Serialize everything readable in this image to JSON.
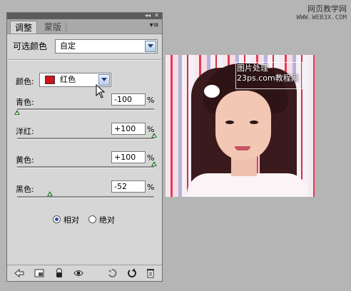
{
  "watermark": {
    "title": "网页教学网",
    "url": "WWW.WEB3X.COM"
  },
  "panel": {
    "tabs": [
      {
        "label": "调整"
      },
      {
        "label": "蒙版"
      }
    ],
    "menu_icon": "panel-menu-icon",
    "preset": {
      "label": "可选颜色",
      "value": "自定"
    },
    "colors": {
      "label": "颜色:",
      "value": "红色",
      "swatch": "#d0141b"
    },
    "sliders": [
      {
        "label": "青色:",
        "value": "-100",
        "unit": "%",
        "level": -100
      },
      {
        "label": "洋红:",
        "value": "+100",
        "unit": "%",
        "level": 100
      },
      {
        "label": "黄色:",
        "value": "+100",
        "unit": "%",
        "level": 100
      },
      {
        "label": "黑色:",
        "value": "-52",
        "unit": "%",
        "level": -52
      }
    ],
    "method": {
      "relative": "相对",
      "absolute": "绝对",
      "selected": "relative"
    }
  },
  "photo": {
    "caption_line1": "图片处理",
    "caption_line2": "23ps.com教程网"
  },
  "colors": {
    "panel_bg": "#d6d6d6",
    "thumb": "#2c7a2c",
    "accent": "#1c4fb0"
  }
}
